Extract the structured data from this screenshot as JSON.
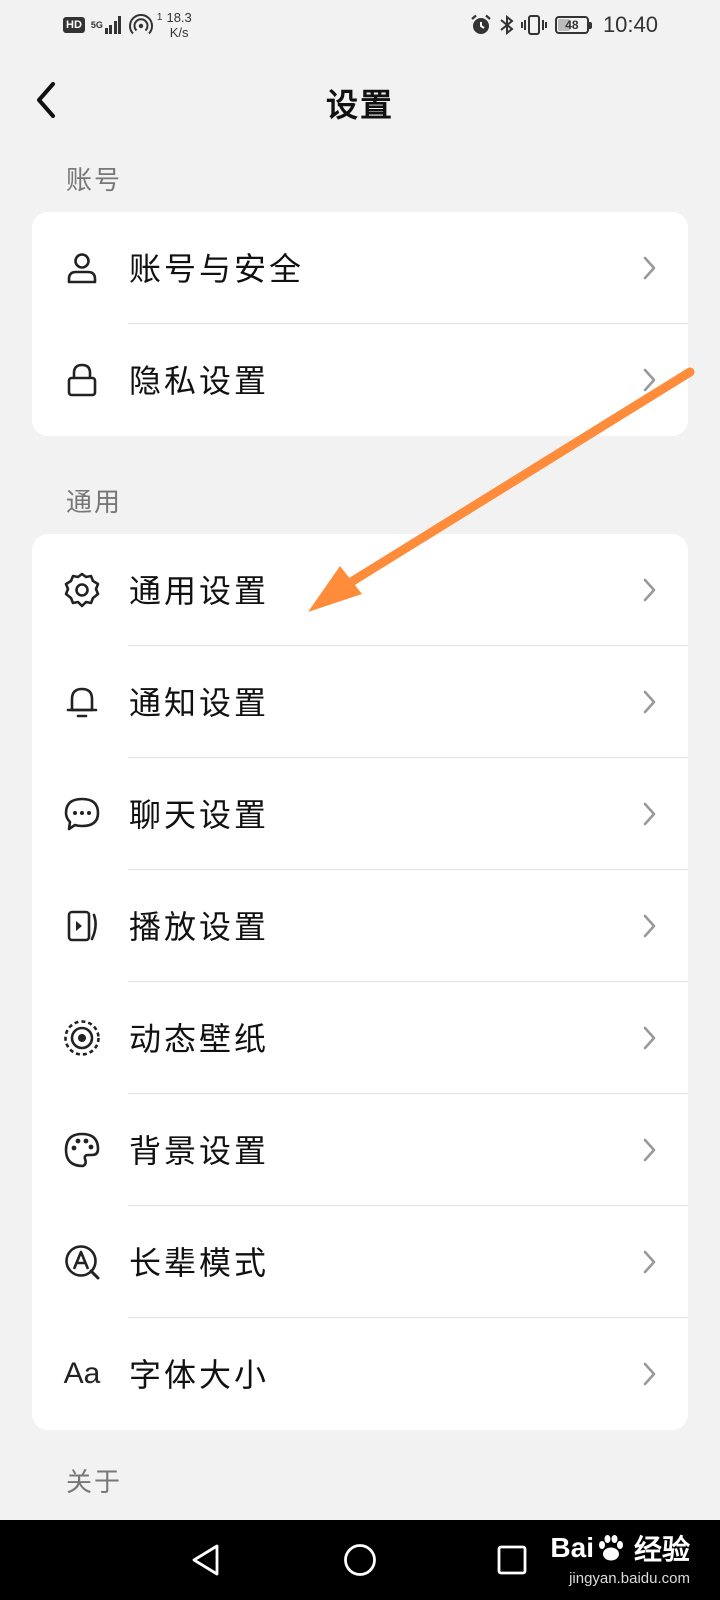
{
  "status_bar": {
    "hd": "HD",
    "network": "5G",
    "net_sim": "1",
    "speed_value": "18.3",
    "speed_unit": "K/s",
    "battery": "48",
    "battery_level": 0.48,
    "time": "10:40"
  },
  "header": {
    "title": "设置"
  },
  "sections": [
    {
      "label": "账号",
      "items": [
        {
          "label": "账号与安全",
          "icon": "person-icon"
        },
        {
          "label": "隐私设置",
          "icon": "lock-icon"
        }
      ]
    },
    {
      "label": "通用",
      "items": [
        {
          "label": "通用设置",
          "icon": "gear-icon"
        },
        {
          "label": "通知设置",
          "icon": "bell-icon"
        },
        {
          "label": "聊天设置",
          "icon": "chat-bubble-icon"
        },
        {
          "label": "播放设置",
          "icon": "play-screen-icon"
        },
        {
          "label": "动态壁纸",
          "icon": "live-wallpaper-icon"
        },
        {
          "label": "背景设置",
          "icon": "palette-icon"
        },
        {
          "label": "长辈模式",
          "icon": "elder-mode-icon"
        },
        {
          "label": "字体大小",
          "icon": "font-size-icon",
          "icon_text": "Aa"
        }
      ]
    },
    {
      "label": "关于"
    }
  ],
  "annotation": {
    "color": "#ff8c3a"
  },
  "watermark": {
    "brand_left": "Bai",
    "brand_right": "经验",
    "url": "jingyan.baidu.com"
  }
}
